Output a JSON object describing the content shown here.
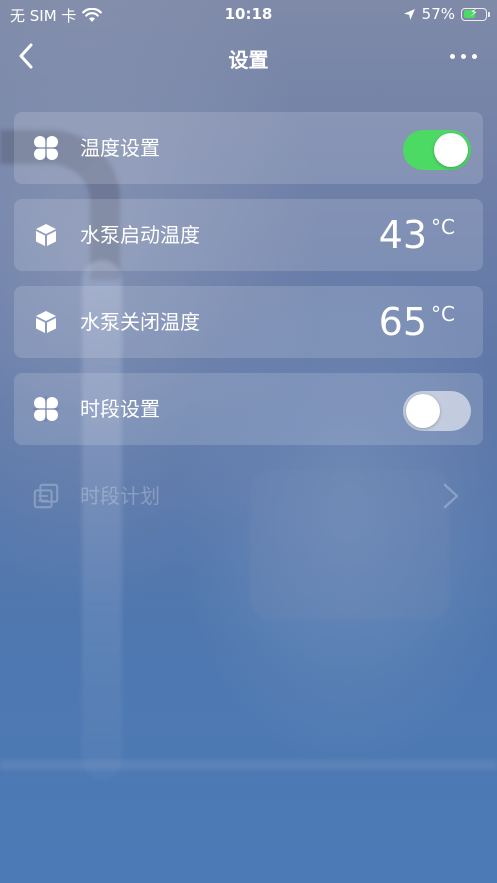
{
  "status_bar": {
    "carrier": "无 SIM 卡",
    "time": "10:18",
    "battery_percent": "57%",
    "battery_level": 0.57
  },
  "nav": {
    "title": "设置"
  },
  "rows": [
    {
      "label": "温度设置",
      "icon": "clover-icon",
      "toggle_on": true
    },
    {
      "label": "水泵启动温度",
      "icon": "cube-icon",
      "value": "43",
      "unit": "°C"
    },
    {
      "label": "水泵关闭温度",
      "icon": "cube-icon",
      "value": "65",
      "unit": "°C"
    },
    {
      "label": "时段设置",
      "icon": "clover-icon",
      "toggle_on": false
    },
    {
      "label": "时段计划",
      "icon": "copy-icon",
      "disabled": true
    }
  ],
  "colors": {
    "toggle_on": "#4cd964",
    "background_top": "#7f8aa8",
    "background_bottom": "#4b7ab6"
  }
}
